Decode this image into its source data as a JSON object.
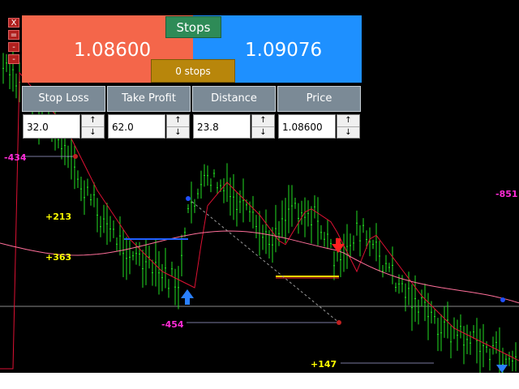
{
  "window_controls": [
    {
      "label": "X"
    },
    {
      "label": "="
    },
    {
      "label": "-"
    },
    {
      "label": "-"
    }
  ],
  "trade_panel": {
    "sell_price": "1.08600",
    "buy_price": "1.09076",
    "stops_button": "Stops",
    "stops_count": "0 stops"
  },
  "fields": [
    {
      "header": "Stop Loss",
      "value": "32.0"
    },
    {
      "header": "Take Profit",
      "value": "62.0"
    },
    {
      "header": "Distance",
      "value": "23.8"
    },
    {
      "header": "Price",
      "value": "1.08600"
    }
  ],
  "spinner": {
    "up": "↑",
    "down": "↓"
  },
  "trade_labels": {
    "l1": "-434",
    "l2": "+213",
    "l3": "+363",
    "l4": "-454",
    "l5": "+147",
    "l6": "-851"
  },
  "colors": {
    "sell": "#f4664a",
    "buy": "#1e90ff",
    "candles": "#22dd22",
    "ma_red": "#dd1133",
    "ma_pink": "#ff6f9a",
    "magenta_label": "#ff2bd6",
    "yellow_label": "#ffff00"
  }
}
